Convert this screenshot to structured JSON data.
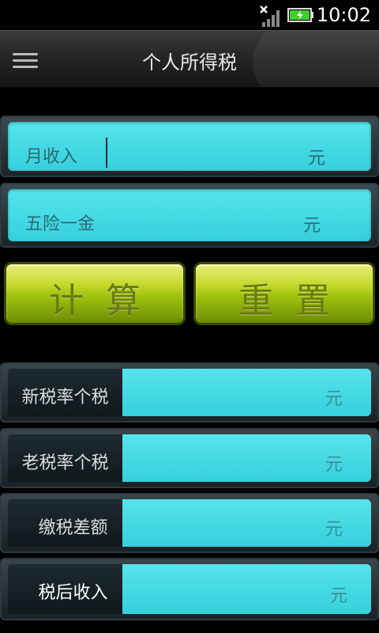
{
  "status": {
    "time": "10:02"
  },
  "header": {
    "title": "个人所得税"
  },
  "inputs": [
    {
      "label": "月收入",
      "unit": "元",
      "value": ""
    },
    {
      "label": "五险一金",
      "unit": "元",
      "value": ""
    }
  ],
  "buttons": {
    "calculate": "计算",
    "reset": "重置"
  },
  "results": [
    {
      "label": "新税率个税",
      "unit": "元"
    },
    {
      "label": "老税率个税",
      "unit": "元"
    },
    {
      "label": "缴税差额",
      "unit": "元"
    },
    {
      "label": "税后收入",
      "unit": "元"
    }
  ],
  "colors": {
    "field": "#35d0dc",
    "button": "#9fc10e",
    "label_text": "#2b6b72"
  }
}
